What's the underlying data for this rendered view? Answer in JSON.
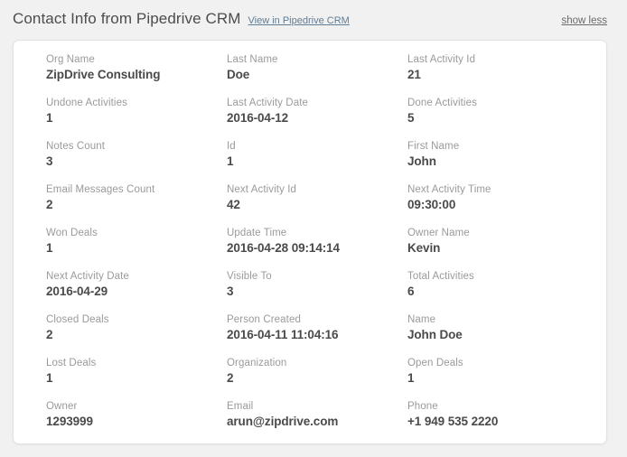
{
  "header": {
    "title": "Contact Info from Pipedrive CRM",
    "link_label": "View in Pipedrive CRM",
    "toggle_label": "show less"
  },
  "card": {
    "fields": [
      {
        "label": "Org Name",
        "value": "ZipDrive Consulting"
      },
      {
        "label": "Last Name",
        "value": "Doe"
      },
      {
        "label": "Last Activity Id",
        "value": "21"
      },
      {
        "label": "Undone Activities",
        "value": "1"
      },
      {
        "label": "Last Activity Date",
        "value": "2016-04-12"
      },
      {
        "label": "Done Activities",
        "value": "5"
      },
      {
        "label": "Notes Count",
        "value": "3"
      },
      {
        "label": "Id",
        "value": "1"
      },
      {
        "label": "First Name",
        "value": "John"
      },
      {
        "label": "Email Messages Count",
        "value": "2"
      },
      {
        "label": "Next Activity Id",
        "value": "42"
      },
      {
        "label": "Next Activity Time",
        "value": "09:30:00"
      },
      {
        "label": "Won Deals",
        "value": "1"
      },
      {
        "label": "Update Time",
        "value": "2016-04-28 09:14:14"
      },
      {
        "label": "Owner Name",
        "value": "Kevin"
      },
      {
        "label": "Next Activity Date",
        "value": "2016-04-29"
      },
      {
        "label": "Visible To",
        "value": "3"
      },
      {
        "label": "Total Activities",
        "value": "6"
      },
      {
        "label": "Closed Deals",
        "value": "2"
      },
      {
        "label": "Person Created",
        "value": "2016-04-11 11:04:16"
      },
      {
        "label": "Name",
        "value": "John Doe"
      },
      {
        "label": "Lost Deals",
        "value": "1"
      },
      {
        "label": "Organization",
        "value": "2"
      },
      {
        "label": "Open Deals",
        "value": "1"
      },
      {
        "label": "Owner",
        "value": "1293999"
      },
      {
        "label": "Email",
        "value": "arun@zipdrive.com"
      },
      {
        "label": "Phone",
        "value": "+1 949 535 2220"
      }
    ]
  },
  "colors": {
    "page_background": "#f1f1f1",
    "card_background": "#ffffff",
    "card_border": "#e2e2e2",
    "title_text": "#4c4c4c",
    "label_text": "#9a9a9a",
    "value_text": "#4a4a4a",
    "link_text": "#5f7d95",
    "toggle_text": "#6b6b6b"
  }
}
